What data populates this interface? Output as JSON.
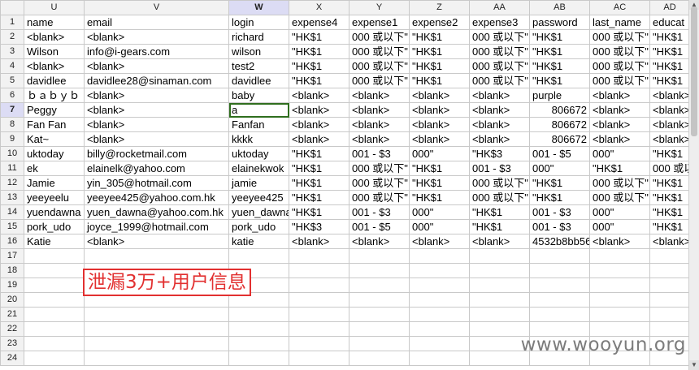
{
  "spreadsheet": {
    "columns": [
      "U",
      "V",
      "W",
      "X",
      "Y",
      "Z",
      "AA",
      "AB",
      "AC",
      "AD"
    ],
    "active_column": "W",
    "active_row": "7",
    "rows": [
      {
        "n": "1",
        "cells": [
          "name",
          "email",
          "login",
          "expense4",
          "expense1",
          "expense2",
          "expense3",
          "password",
          "last_name",
          "educat"
        ]
      },
      {
        "n": "2",
        "cells": [
          "<blank>",
          "<blank>",
          "richard",
          "\"HK$1",
          "000 或以下\"",
          "\"HK$1",
          "000 或以下\"",
          "\"HK$1",
          "000 或以下\"",
          "\"HK$1"
        ]
      },
      {
        "n": "3",
        "cells": [
          "Wilson",
          "info@i-gears.com",
          "wilson",
          "\"HK$1",
          "000 或以下\"",
          "\"HK$1",
          "000 或以下\"",
          "\"HK$1",
          "000 或以下\"",
          "\"HK$1"
        ]
      },
      {
        "n": "4",
        "cells": [
          "<blank>",
          "<blank>",
          "test2",
          "\"HK$1",
          "000 或以下\"",
          "\"HK$1",
          "000 或以下\"",
          "\"HK$1",
          "000 或以下\"",
          "\"HK$1"
        ]
      },
      {
        "n": "5",
        "cells": [
          "davidlee",
          "davidlee28@sinaman.com",
          "davidlee",
          "\"HK$1",
          "000 或以下\"",
          "\"HK$1",
          "000 或以下\"",
          "\"HK$1",
          "000 或以下\"",
          "\"HK$1"
        ]
      },
      {
        "n": "6",
        "cells": [
          "ｂａｂｙｂ",
          "<blank>",
          "baby",
          "<blank>",
          "<blank>",
          "<blank>",
          "<blank>",
          "purple",
          "<blank>",
          "<blank>"
        ]
      },
      {
        "n": "7",
        "cells": [
          "Peggy",
          "<blank>",
          "a",
          "<blank>",
          "<blank>",
          "<blank>",
          "<blank>",
          "806672",
          "<blank>",
          "<blank>"
        ]
      },
      {
        "n": "8",
        "cells": [
          "Fan Fan",
          "<blank>",
          "Fanfan",
          "<blank>",
          "<blank>",
          "<blank>",
          "<blank>",
          "806672",
          "<blank>",
          "<blank>"
        ]
      },
      {
        "n": "9",
        "cells": [
          "Kat~",
          "<blank>",
          "kkkk",
          "<blank>",
          "<blank>",
          "<blank>",
          "<blank>",
          "806672",
          "<blank>",
          "<blank>"
        ]
      },
      {
        "n": "10",
        "cells": [
          "uktoday",
          "billy@rocketmail.com",
          "uktoday",
          "\"HK$1",
          "001 - $3",
          "000\"",
          "\"HK$3",
          "001 - $5",
          "000\"",
          "\"HK$1"
        ]
      },
      {
        "n": "11",
        "cells": [
          "ek",
          "elainelk@yahoo.com",
          "elainekwok",
          "\"HK$1",
          "000 或以下\"",
          "\"HK$1",
          "001 - $3",
          "000\"",
          "\"HK$1",
          "000 或以"
        ]
      },
      {
        "n": "12",
        "cells": [
          "Jamie",
          "yin_305@hotmail.com",
          "jamie",
          "\"HK$1",
          "000 或以下\"",
          "\"HK$1",
          "000 或以下\"",
          "\"HK$1",
          "000 或以下\"",
          "\"HK$1"
        ]
      },
      {
        "n": "13",
        "cells": [
          "yeeyeelu",
          "yeeyee425@yahoo.com.hk",
          "yeeyee425",
          "\"HK$1",
          "000 或以下\"",
          "\"HK$1",
          "000 或以下\"",
          "\"HK$1",
          "000 或以下\"",
          "\"HK$1"
        ]
      },
      {
        "n": "14",
        "cells": [
          "yuendawna",
          "yuen_dawna@yahoo.com.hk",
          "yuen_dawna",
          "\"HK$1",
          "001 - $3",
          "000\"",
          "\"HK$1",
          "001 - $3",
          "000\"",
          "\"HK$1"
        ]
      },
      {
        "n": "15",
        "cells": [
          "pork_udo",
          "joyce_1999@hotmail.com",
          "pork_udo",
          "\"HK$3",
          "001 - $5",
          "000\"",
          "\"HK$1",
          "001 - $3",
          "000\"",
          "\"HK$1"
        ]
      },
      {
        "n": "16",
        "cells": [
          "Katie",
          "<blank>",
          "katie",
          "<blank>",
          "<blank>",
          "<blank>",
          "<blank>",
          "4532b8bb56",
          "<blank>",
          "<blank>"
        ]
      },
      {
        "n": "17",
        "cells": [
          "",
          "",
          "",
          "",
          "",
          "",
          "",
          "",
          "",
          ""
        ]
      },
      {
        "n": "18",
        "cells": [
          "",
          "",
          "",
          "",
          "",
          "",
          "",
          "",
          "",
          ""
        ]
      },
      {
        "n": "19",
        "cells": [
          "",
          "",
          "",
          "",
          "",
          "",
          "",
          "",
          "",
          ""
        ]
      },
      {
        "n": "20",
        "cells": [
          "",
          "",
          "",
          "",
          "",
          "",
          "",
          "",
          "",
          ""
        ]
      },
      {
        "n": "21",
        "cells": [
          "",
          "",
          "",
          "",
          "",
          "",
          "",
          "",
          "",
          ""
        ]
      },
      {
        "n": "22",
        "cells": [
          "",
          "",
          "",
          "",
          "",
          "",
          "",
          "",
          "",
          ""
        ]
      },
      {
        "n": "23",
        "cells": [
          "",
          "",
          "",
          "",
          "",
          "",
          "",
          "",
          "",
          ""
        ]
      },
      {
        "n": "24",
        "cells": [
          "",
          "",
          "",
          "",
          "",
          "",
          "",
          "",
          "",
          ""
        ]
      }
    ]
  },
  "overlay": {
    "banner_text": "泄漏3万+用户信息",
    "banner_color": "#e23030",
    "watermark": "www.wooyun.org"
  },
  "icons": {
    "scroll_up": "scroll-up-arrow-icon",
    "scroll_down": "scroll-down-arrow-icon"
  }
}
